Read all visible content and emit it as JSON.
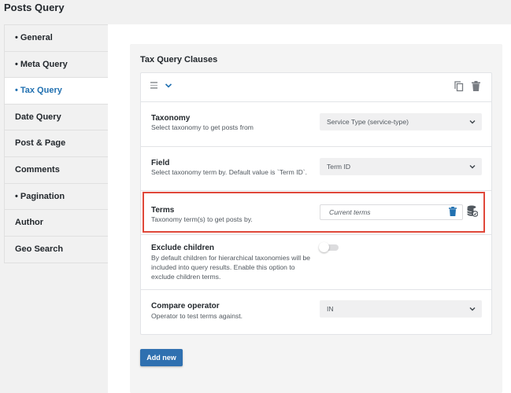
{
  "page": {
    "title": "Posts Query"
  },
  "sidebar": {
    "items": [
      {
        "label": "General",
        "bullet": "•"
      },
      {
        "label": "Meta Query",
        "bullet": "•"
      },
      {
        "label": "Tax Query",
        "bullet": "•"
      },
      {
        "label": "Date Query",
        "bullet": ""
      },
      {
        "label": "Post & Page",
        "bullet": ""
      },
      {
        "label": "Comments",
        "bullet": ""
      },
      {
        "label": "Pagination",
        "bullet": "•"
      },
      {
        "label": "Author",
        "bullet": ""
      },
      {
        "label": "Geo Search",
        "bullet": ""
      }
    ],
    "active_index": 2
  },
  "panel": {
    "title": "Tax Query Clauses",
    "add_button": "Add new"
  },
  "clause": {
    "fields": {
      "taxonomy": {
        "label": "Taxonomy",
        "description": "Select taxonomy to get posts from",
        "value": "Service Type (service-type)"
      },
      "field": {
        "label": "Field",
        "description": "Select taxonomy term by. Default value is `Term ID`.",
        "value": "Term ID"
      },
      "terms": {
        "label": "Terms",
        "description": "Taxonomy term(s) to get posts by.",
        "placeholder": "Current terms"
      },
      "exclude_children": {
        "label": "Exclude children",
        "description": "By default children for hierarchical taxonomies will be included into query results. Enable this option to exclude children terms.",
        "enabled": false
      },
      "compare": {
        "label": "Compare operator",
        "description": "Operator to test terms against.",
        "value": "IN"
      }
    }
  },
  "colors": {
    "accent": "#2271b1",
    "button": "#2f70b0",
    "highlight": "#e0483a"
  },
  "icons": [
    "drag-handle-icon",
    "chevron-down-icon",
    "copy-icon",
    "trash-icon",
    "database-icon"
  ]
}
